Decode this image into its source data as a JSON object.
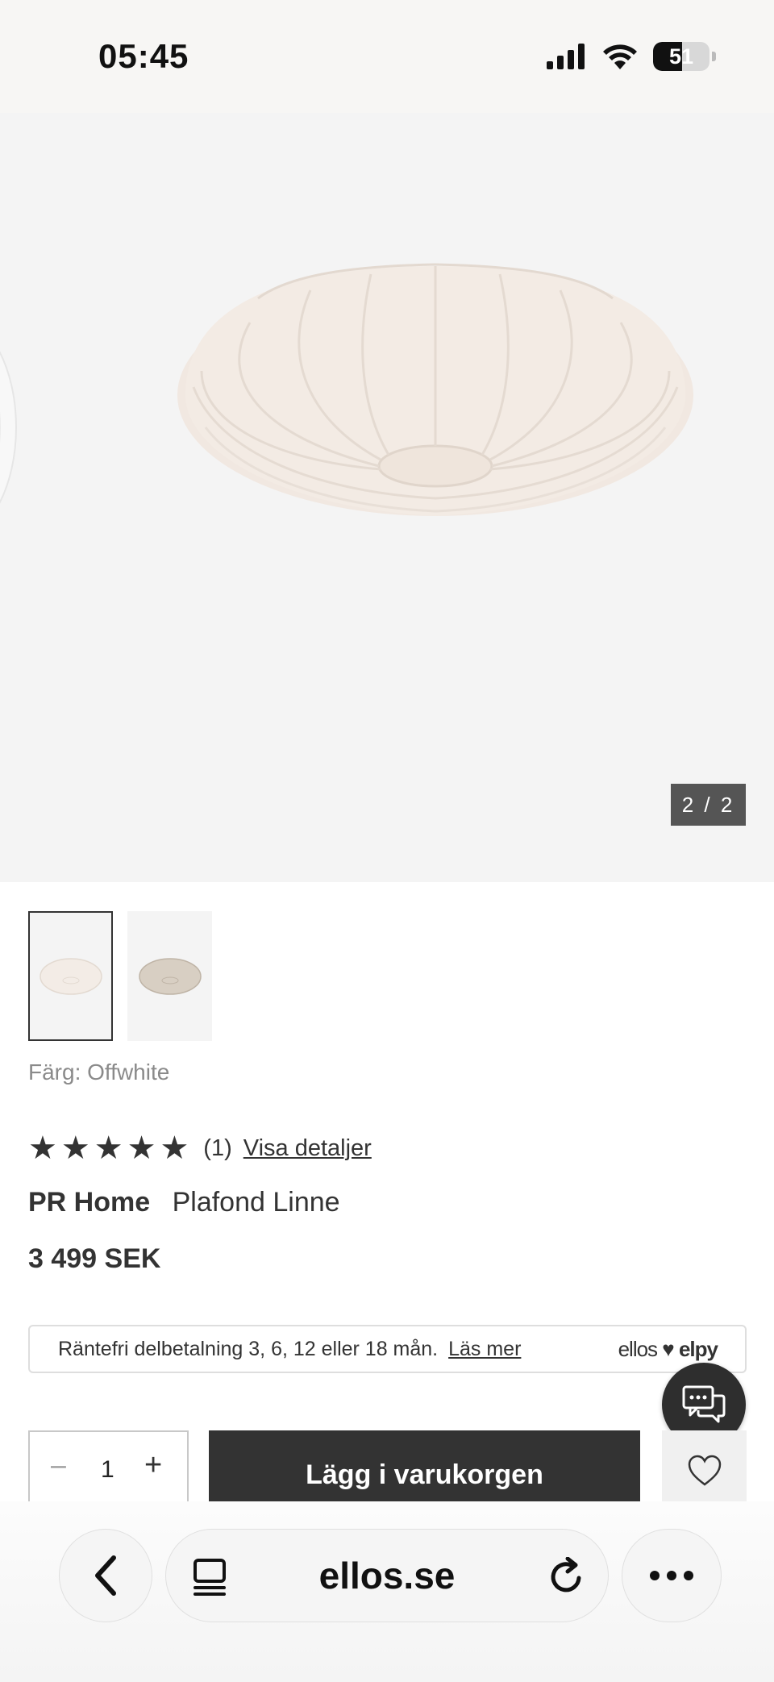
{
  "status_bar": {
    "time": "05:45",
    "battery": "51",
    "battery_level": 0.51
  },
  "gallery": {
    "counter": "2 / 2"
  },
  "product": {
    "color_label": "Färg: Offwhite",
    "rating": {
      "stars": 5,
      "count": "(1)",
      "details_link": "Visa detaljer"
    },
    "brand": "PR Home",
    "name": "Plafond Linne",
    "price": "3 499 SEK"
  },
  "installment": {
    "text": "Räntefri delbetalning 3, 6, 12 eller 18 mån.",
    "link": "Läs mer",
    "partner_left": "ellos",
    "partner_right": "elpy"
  },
  "cart": {
    "quantity": "1",
    "minus": "–",
    "plus": "+",
    "add_label": "Lägg i varukorgen"
  },
  "browser": {
    "url": "ellos.se"
  },
  "icons": {
    "signal": "signal-icon",
    "wifi": "wifi-icon",
    "battery": "battery-icon",
    "chat": "chat-icon",
    "heart": "heart-icon",
    "back": "chevron-left-icon",
    "tabs": "tabs-icon",
    "reload": "reload-icon",
    "more": "more-icon",
    "star": "star-icon"
  },
  "colors": {
    "dark": "#333333",
    "counter_bg": "#555555",
    "gallery_bg": "#f4f4f4"
  }
}
